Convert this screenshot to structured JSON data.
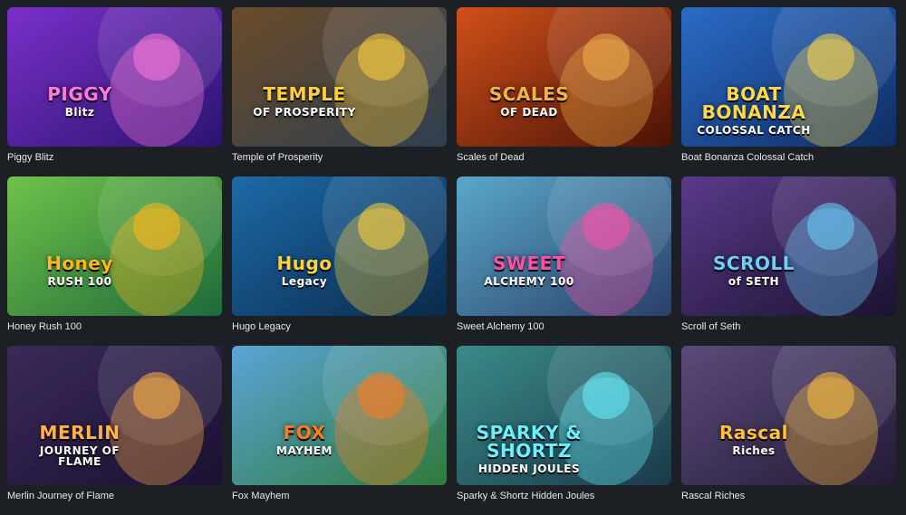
{
  "games": [
    {
      "title": "Piggy Blitz",
      "logo": [
        "PIGGY",
        "Blitz"
      ],
      "bg": [
        "#7a2fc9",
        "#2b1470"
      ],
      "accent": "#ff7ad9",
      "icon": "pig-character-icon"
    },
    {
      "title": "Temple of Prosperity",
      "logo": [
        "TEMPLE",
        "OF PROSPERITY"
      ],
      "bg": [
        "#6b4b2a",
        "#2e3f4f"
      ],
      "accent": "#ffcf3a",
      "icon": "god-of-wealth-icon"
    },
    {
      "title": "Scales of Dead",
      "logo": [
        "SCALES",
        "OF DEAD"
      ],
      "bg": [
        "#d0501a",
        "#4a1206"
      ],
      "accent": "#f2b24a",
      "icon": "cobra-icon"
    },
    {
      "title": "Boat Bonanza Colossal Catch",
      "logo": [
        "BOAT BONANZA",
        "COLOSSAL CATCH"
      ],
      "bg": [
        "#2b6bc7",
        "#0f2d63"
      ],
      "accent": "#ffd84a",
      "icon": "boat-icon"
    },
    {
      "title": "Honey Rush 100",
      "logo": [
        "Honey",
        "RUSH 100"
      ],
      "bg": [
        "#6fc24a",
        "#1f6a3a"
      ],
      "accent": "#ffb81c",
      "icon": "bee-icon"
    },
    {
      "title": "Hugo Legacy",
      "logo": [
        "Hugo",
        "Legacy"
      ],
      "bg": [
        "#1d6aa8",
        "#0a2a4a"
      ],
      "accent": "#ffd23a",
      "icon": "troll-icon"
    },
    {
      "title": "Sweet Alchemy 100",
      "logo": [
        "SWEET",
        "ALCHEMY 100"
      ],
      "bg": [
        "#5aa8c8",
        "#2a3f6a"
      ],
      "accent": "#ff4fa8",
      "icon": "witch-icon"
    },
    {
      "title": "Scroll of Seth",
      "logo": [
        "SCROLL",
        "of SETH"
      ],
      "bg": [
        "#5a3a8a",
        "#1b1230"
      ],
      "accent": "#6ad1ff",
      "icon": "anubis-icon"
    },
    {
      "title": "Merlin Journey of Flame",
      "logo": [
        "MERLIN",
        "JOURNEY OF FLAME"
      ],
      "bg": [
        "#3a2a5a",
        "#1a1030"
      ],
      "accent": "#ffb347",
      "icon": "wizard-icon"
    },
    {
      "title": "Fox Mayhem",
      "logo": [
        "FOX",
        "MAYHEM"
      ],
      "bg": [
        "#5aa4d8",
        "#2f7a3a"
      ],
      "accent": "#ff7a1a",
      "icon": "fox-icon"
    },
    {
      "title": "Sparky & Shortz Hidden Joules",
      "logo": [
        "SPARKY & SHORTZ",
        "HIDDEN JOULES"
      ],
      "bg": [
        "#3a8a8a",
        "#1a3a4a"
      ],
      "accent": "#6af0ff",
      "icon": "robot-icon"
    },
    {
      "title": "Rascal Riches",
      "logo": [
        "Rascal",
        "Riches"
      ],
      "bg": [
        "#5a4a7a",
        "#241a35"
      ],
      "accent": "#ffc13a",
      "icon": "raccoon-icon"
    }
  ]
}
